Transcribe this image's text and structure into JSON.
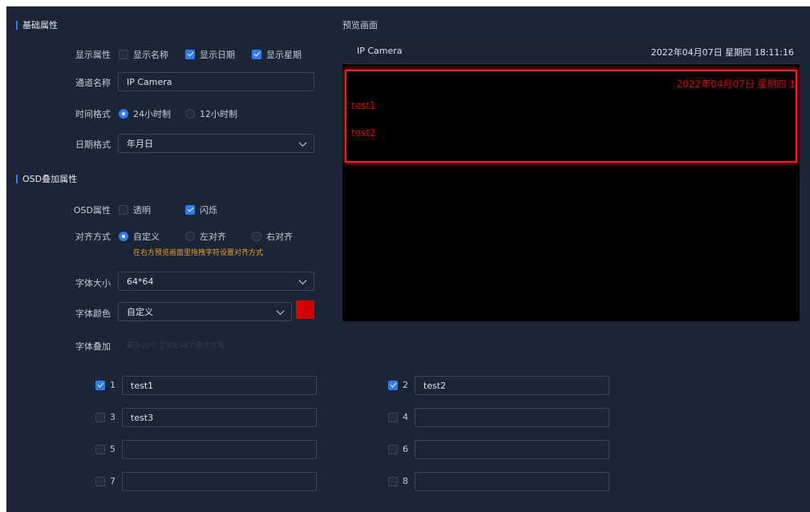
{
  "basic": {
    "title": "基础属性",
    "display_label": "显示属性",
    "display_options": [
      {
        "label": "显示名称",
        "checked": false
      },
      {
        "label": "显示日期",
        "checked": true
      },
      {
        "label": "显示星期",
        "checked": true
      }
    ],
    "channel_label": "通道名称",
    "channel_value": "IP Camera",
    "time_label": "时间格式",
    "time_options": [
      {
        "label": "24小时制",
        "selected": true
      },
      {
        "label": "12小时制",
        "selected": false
      }
    ],
    "date_label": "日期格式",
    "date_value": "年月日"
  },
  "osd": {
    "title": "OSD叠加属性",
    "attr_label": "OSD属性",
    "attr_options": [
      {
        "label": "透明",
        "checked": false
      },
      {
        "label": "闪烁",
        "checked": true
      }
    ],
    "align_label": "对齐方式",
    "align_options": [
      {
        "label": "自定义",
        "selected": true
      },
      {
        "label": "左对齐",
        "selected": false
      },
      {
        "label": "右对齐",
        "selected": false
      }
    ],
    "align_hint": "在右方预览画面里拖拽字符设置对齐方式",
    "font_size_label": "字体大小",
    "font_size_value": "64*64",
    "font_color_label": "字体颜色",
    "font_color_value": "自定义",
    "font_color_swatch": "#d40000",
    "overlay_label": "字体叠加",
    "overlay_hint": "最多22个汉字或44个英文字母",
    "items": [
      {
        "num": "1",
        "checked": true,
        "value": "test1"
      },
      {
        "num": "2",
        "checked": true,
        "value": "test2"
      },
      {
        "num": "3",
        "checked": false,
        "value": "test3"
      },
      {
        "num": "4",
        "checked": false,
        "value": ""
      },
      {
        "num": "5",
        "checked": false,
        "value": ""
      },
      {
        "num": "6",
        "checked": false,
        "value": ""
      },
      {
        "num": "7",
        "checked": false,
        "value": ""
      },
      {
        "num": "8",
        "checked": false,
        "value": ""
      }
    ]
  },
  "preview": {
    "title": "预览画面",
    "camera_name": "IP Camera",
    "timestamp": "2022年04月07日 星期四 18:11:16",
    "overlay_date": "2022年04月07日 星期四 1",
    "overlay_lines": [
      "test1",
      "test2"
    ]
  }
}
